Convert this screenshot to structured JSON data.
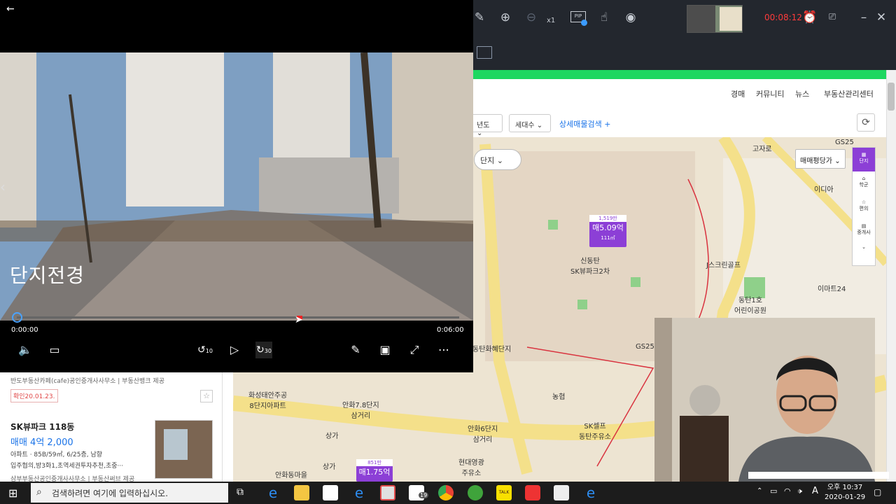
{
  "player": {
    "back_icon": "back-arrow-icon",
    "caption": "단지전경",
    "time_current": "0:00:00",
    "time_total": "0:06:00",
    "progress": 0.64,
    "skip_back_label": "10",
    "skip_fwd_label": "30"
  },
  "recorder": {
    "timer": "00:08:12",
    "zoom_label": "x1",
    "pip_label": "PIP"
  },
  "webpage": {
    "nav": [
      "경매",
      "커뮤니티",
      "뉴스",
      "부동산관리센터"
    ],
    "filters": [
      "년도",
      "세대수"
    ],
    "advanced_search": "상세매물검색",
    "complex_toggle": "단지",
    "price_type": "매매평당가",
    "side_tools": [
      "단지",
      "학군",
      "편의",
      "중개사"
    ],
    "map_labels": {
      "gs25_top": "GS25",
      "gs25_mid": "GS25",
      "school_area": "학군",
      "idia": "이디아",
      "sk2": "신동탄\nSK뷰파크2차",
      "jgolf": "J스크린골프",
      "emart": "이마트24",
      "dongtan1": "동탄1호\n어린이공원",
      "hanwha": "동탄화혜단지",
      "nonghyup": "농협",
      "skself": "SK셀프\n동탄주유소",
      "hyundai": "현대영광\n주유소",
      "ansan_7": "안화7.8단지\n삼거리",
      "ansan_6": "안화6단지\n삼거리",
      "hwaseong": "화성태안주공\n8단지아파트",
      "sanga1": "상가",
      "sanga2": "상가",
      "ansan_village": "안화동마을",
      "gochaek": "고자로"
    },
    "markers": [
      {
        "top": "1,519만",
        "price": "매5.09억",
        "area": "111㎡"
      },
      {
        "top": "851만",
        "price": "매1.75억",
        "area": ""
      }
    ],
    "listing": {
      "source1": "반도부동산카페(cafe)공인중개사사무소",
      "source1_provider": "부동산뱅크 제공",
      "confirm_badge": "확인20.01.23.",
      "title": "SK뷰파크 118동",
      "price": "매매 4억 2,000",
      "detail1": "아파트 · 85B/59㎡, 6/25층, 남향",
      "detail2": "입주협의,방3화1,초역세권투자추천,초중···",
      "source2": "삼부부동산공인중개사사무소",
      "source2_provider": "부동산써브 제공"
    }
  },
  "taskbar": {
    "search_placeholder": "검색하려면 여기에 입력하십시오.",
    "time": "오후 10:37",
    "date": "2020-01-29",
    "mail_badge": "19",
    "ime": "A"
  }
}
